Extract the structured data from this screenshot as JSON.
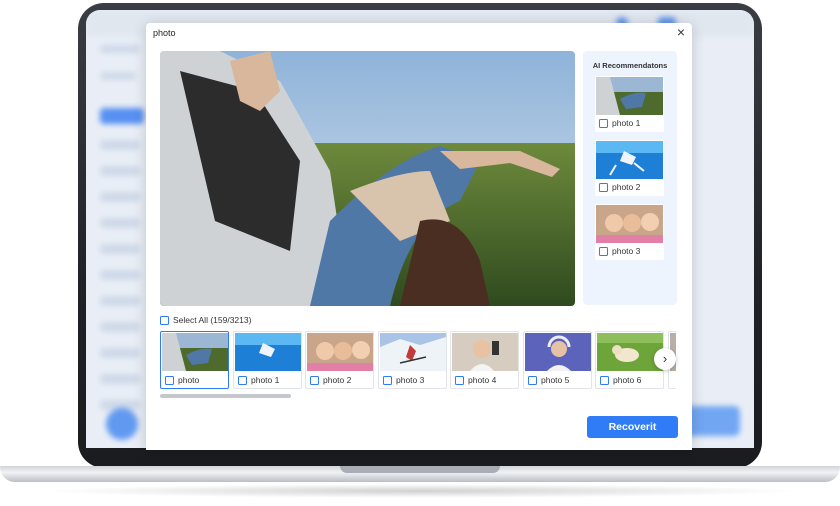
{
  "dialog": {
    "title": "photo",
    "close_icon": "close-icon"
  },
  "ai_panel": {
    "title": "AI Recommendatons",
    "items": [
      {
        "label": "photo 1",
        "checked": false
      },
      {
        "label": "photo 2",
        "checked": false
      },
      {
        "label": "photo 3",
        "checked": false
      }
    ]
  },
  "select_all": {
    "label": "Select All (159/3213)",
    "checked": false
  },
  "filmstrip": {
    "items": [
      {
        "label": "photo",
        "selected": true,
        "checked": false
      },
      {
        "label": "photo 1",
        "selected": false,
        "checked": false
      },
      {
        "label": "photo 2",
        "selected": false,
        "checked": false
      },
      {
        "label": "photo 3",
        "selected": false,
        "checked": false
      },
      {
        "label": "photo 4",
        "selected": false,
        "checked": false
      },
      {
        "label": "photo 5",
        "selected": false,
        "checked": false
      },
      {
        "label": "photo 6",
        "selected": false,
        "checked": false
      }
    ],
    "next_icon": "chevron-right-icon"
  },
  "recover_button": {
    "label": "Recoverit"
  },
  "colors": {
    "accent": "#2f7cf6",
    "panel_bg": "#eef4fd"
  }
}
